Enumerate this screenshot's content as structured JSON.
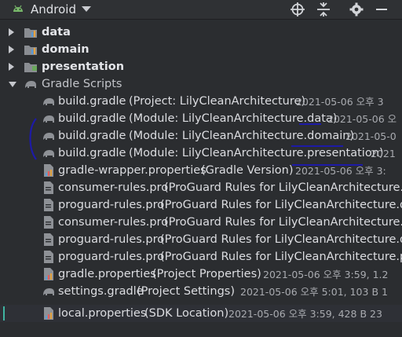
{
  "toolbar": {
    "title": "Android",
    "buttons": [
      "crosshair-icon",
      "collapse-icon",
      "gear-icon",
      "minimize-icon"
    ]
  },
  "tree": {
    "modules": [
      {
        "label": "data"
      },
      {
        "label": "domain"
      },
      {
        "label": "presentation"
      }
    ],
    "gradle_scripts_label": "Gradle Scripts",
    "files": [
      {
        "name": "build.gradle",
        "detail": "(Project: LilyCleanArchitecture)",
        "meta": "2021-05-06 오후 3"
      },
      {
        "name": "build.gradle",
        "detail": "(Module: LilyCleanArchitecture.data)",
        "meta": "2021-05-06 오"
      },
      {
        "name": "build.gradle",
        "detail": "(Module: LilyCleanArchitecture.domain)",
        "meta": "2021-05-0"
      },
      {
        "name": "build.gradle",
        "detail": "(Module: LilyCleanArchitecture.presentation)",
        "meta": "2021"
      },
      {
        "name": "gradle-wrapper.properties",
        "detail": "(Gradle Version)",
        "meta": "2021-05-06 오후 3:"
      },
      {
        "name": "consumer-rules.pro",
        "detail": "(ProGuard Rules for LilyCleanArchitecture.d",
        "meta": ""
      },
      {
        "name": "proguard-rules.pro",
        "detail": "(ProGuard Rules for LilyCleanArchitecture.d",
        "meta": ""
      },
      {
        "name": "consumer-rules.pro",
        "detail": "(ProGuard Rules for LilyCleanArchitecture.d",
        "meta": ""
      },
      {
        "name": "proguard-rules.pro",
        "detail": "(ProGuard Rules for LilyCleanArchitecture.d",
        "meta": ""
      },
      {
        "name": "proguard-rules.pro",
        "detail": "(ProGuard Rules for LilyCleanArchitecture.p",
        "meta": ""
      },
      {
        "name": "gradle.properties",
        "detail": "(Project Properties)",
        "meta": "2021-05-06 오후 3:59, 1.2"
      },
      {
        "name": "settings.gradle",
        "detail": "(Project Settings)",
        "meta": "2021-05-06 오후 5:01, 103 B 1"
      },
      {
        "name": "local.properties",
        "detail": "(SDK Location)",
        "meta": "2021-05-06 오후 3:59, 428 B 23"
      }
    ]
  },
  "colors": {
    "background": "#2b2d30",
    "selection": "#2e3036",
    "annotation": "#1d1aa6"
  }
}
